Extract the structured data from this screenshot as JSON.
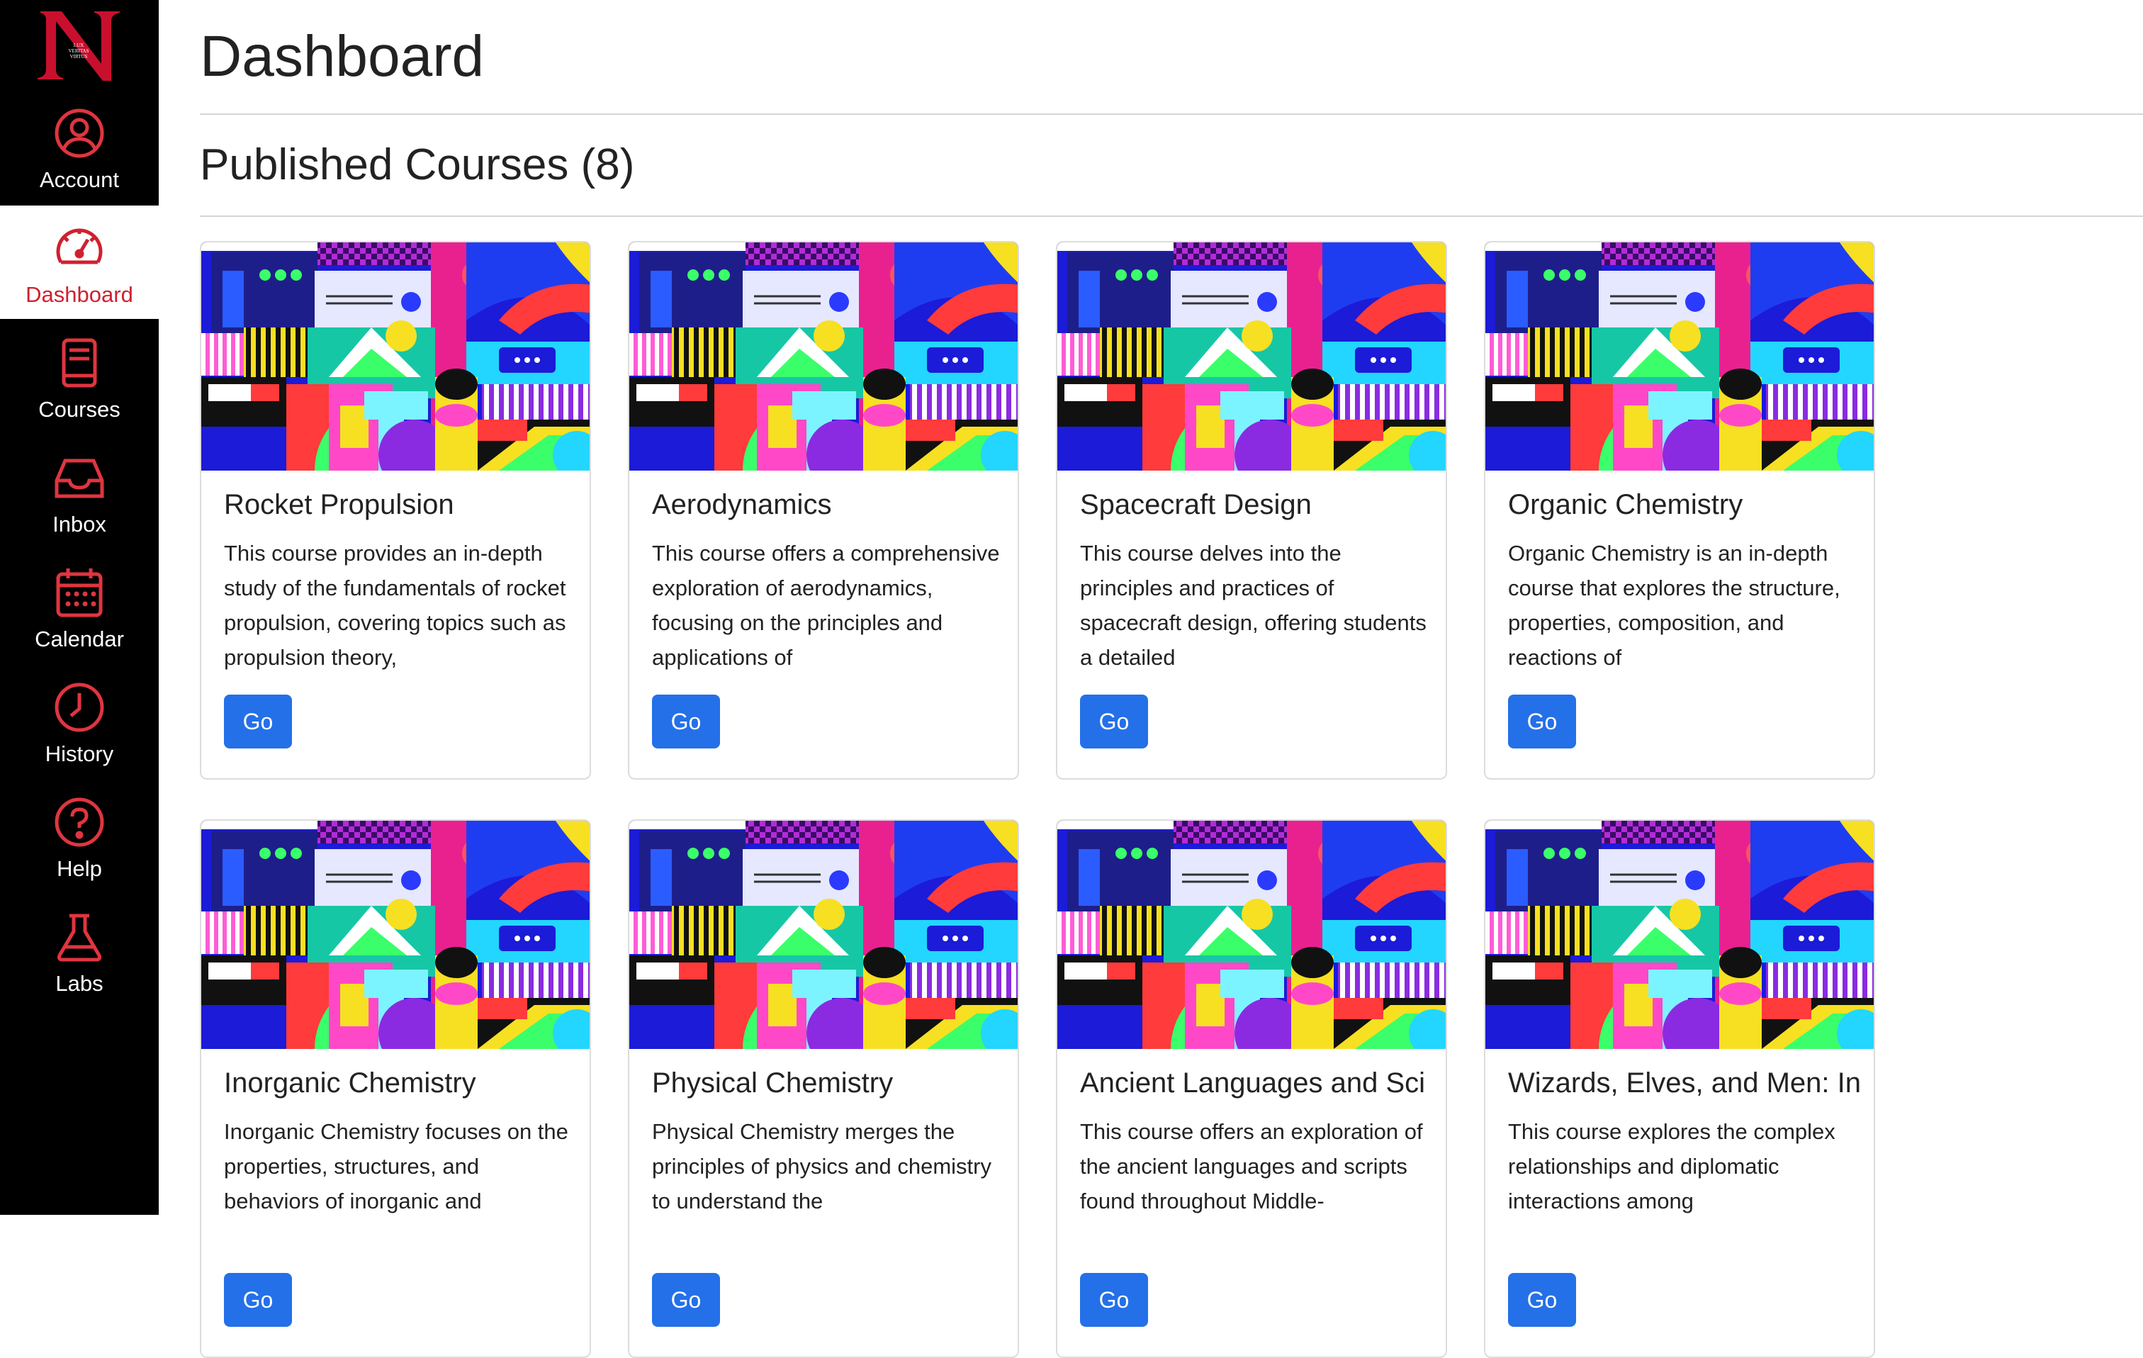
{
  "sidebar": {
    "logo_icon": "logo-n-icon",
    "items": [
      {
        "label": "Account",
        "icon": "account-circle-icon",
        "active": false
      },
      {
        "label": "Dashboard",
        "icon": "speedometer-icon",
        "active": true
      },
      {
        "label": "Courses",
        "icon": "book-icon",
        "active": false
      },
      {
        "label": "Inbox",
        "icon": "inbox-icon",
        "active": false
      },
      {
        "label": "Calendar",
        "icon": "calendar-icon",
        "active": false
      },
      {
        "label": "History",
        "icon": "clock-icon",
        "active": false
      },
      {
        "label": "Help",
        "icon": "help-circle-icon",
        "active": false
      },
      {
        "label": "Labs",
        "icon": "flask-icon",
        "active": false
      }
    ]
  },
  "page": {
    "title": "Dashboard",
    "section_title": "Published Courses (8)"
  },
  "courses": [
    {
      "title": "Rocket Propulsion",
      "description": "This course provides an in-depth study of the fundamentals of rocket propulsion, covering topics such as propulsion theory,",
      "button": "Go"
    },
    {
      "title": "Aerodynamics",
      "description": "This course offers a comprehensive exploration of aerodynamics, focusing on the principles and applications of",
      "button": "Go"
    },
    {
      "title": "Spacecraft Design",
      "description": "This course delves into the principles and practices of spacecraft design, offering students a detailed",
      "button": "Go"
    },
    {
      "title": "Organic Chemistry",
      "description": "Organic Chemistry is an in-depth course that explores the structure, properties, composition, and reactions of",
      "button": "Go"
    },
    {
      "title": "Inorganic Chemistry",
      "description": "Inorganic Chemistry focuses on the properties, structures, and behaviors of inorganic and",
      "button": "Go"
    },
    {
      "title": "Physical Chemistry",
      "description": "Physical Chemistry merges the principles of physics and chemistry to understand the",
      "button": "Go"
    },
    {
      "title": "Ancient Languages and Sci",
      "description": "This course offers an exploration of the ancient languages and scripts found throughout Middle-",
      "button": "Go"
    },
    {
      "title": "Wizards, Elves, and Men: In",
      "description": "This course explores the complex relationships and diplomatic interactions among",
      "button": "Go"
    }
  ],
  "colors": {
    "sidebar_bg": "#000000",
    "accent_red": "#d0202e",
    "button_blue": "#2470e8"
  }
}
